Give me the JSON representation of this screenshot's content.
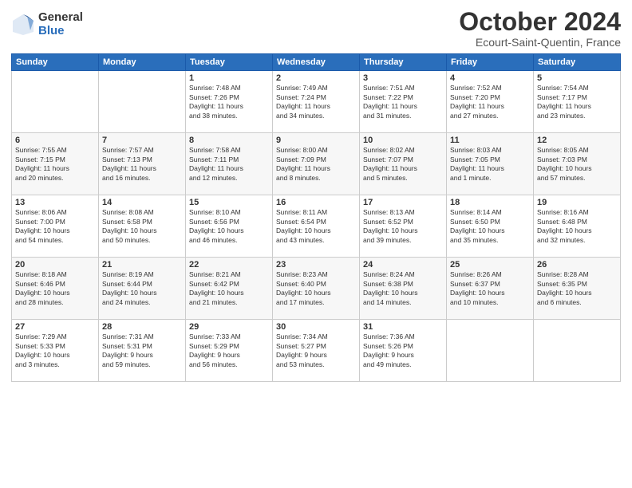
{
  "header": {
    "logo_general": "General",
    "logo_blue": "Blue",
    "month": "October 2024",
    "location": "Ecourt-Saint-Quentin, France"
  },
  "weekdays": [
    "Sunday",
    "Monday",
    "Tuesday",
    "Wednesday",
    "Thursday",
    "Friday",
    "Saturday"
  ],
  "weeks": [
    [
      {
        "day": "",
        "text": ""
      },
      {
        "day": "",
        "text": ""
      },
      {
        "day": "1",
        "text": "Sunrise: 7:48 AM\nSunset: 7:26 PM\nDaylight: 11 hours\nand 38 minutes."
      },
      {
        "day": "2",
        "text": "Sunrise: 7:49 AM\nSunset: 7:24 PM\nDaylight: 11 hours\nand 34 minutes."
      },
      {
        "day": "3",
        "text": "Sunrise: 7:51 AM\nSunset: 7:22 PM\nDaylight: 11 hours\nand 31 minutes."
      },
      {
        "day": "4",
        "text": "Sunrise: 7:52 AM\nSunset: 7:20 PM\nDaylight: 11 hours\nand 27 minutes."
      },
      {
        "day": "5",
        "text": "Sunrise: 7:54 AM\nSunset: 7:17 PM\nDaylight: 11 hours\nand 23 minutes."
      }
    ],
    [
      {
        "day": "6",
        "text": "Sunrise: 7:55 AM\nSunset: 7:15 PM\nDaylight: 11 hours\nand 20 minutes."
      },
      {
        "day": "7",
        "text": "Sunrise: 7:57 AM\nSunset: 7:13 PM\nDaylight: 11 hours\nand 16 minutes."
      },
      {
        "day": "8",
        "text": "Sunrise: 7:58 AM\nSunset: 7:11 PM\nDaylight: 11 hours\nand 12 minutes."
      },
      {
        "day": "9",
        "text": "Sunrise: 8:00 AM\nSunset: 7:09 PM\nDaylight: 11 hours\nand 8 minutes."
      },
      {
        "day": "10",
        "text": "Sunrise: 8:02 AM\nSunset: 7:07 PM\nDaylight: 11 hours\nand 5 minutes."
      },
      {
        "day": "11",
        "text": "Sunrise: 8:03 AM\nSunset: 7:05 PM\nDaylight: 11 hours\nand 1 minute."
      },
      {
        "day": "12",
        "text": "Sunrise: 8:05 AM\nSunset: 7:03 PM\nDaylight: 10 hours\nand 57 minutes."
      }
    ],
    [
      {
        "day": "13",
        "text": "Sunrise: 8:06 AM\nSunset: 7:00 PM\nDaylight: 10 hours\nand 54 minutes."
      },
      {
        "day": "14",
        "text": "Sunrise: 8:08 AM\nSunset: 6:58 PM\nDaylight: 10 hours\nand 50 minutes."
      },
      {
        "day": "15",
        "text": "Sunrise: 8:10 AM\nSunset: 6:56 PM\nDaylight: 10 hours\nand 46 minutes."
      },
      {
        "day": "16",
        "text": "Sunrise: 8:11 AM\nSunset: 6:54 PM\nDaylight: 10 hours\nand 43 minutes."
      },
      {
        "day": "17",
        "text": "Sunrise: 8:13 AM\nSunset: 6:52 PM\nDaylight: 10 hours\nand 39 minutes."
      },
      {
        "day": "18",
        "text": "Sunrise: 8:14 AM\nSunset: 6:50 PM\nDaylight: 10 hours\nand 35 minutes."
      },
      {
        "day": "19",
        "text": "Sunrise: 8:16 AM\nSunset: 6:48 PM\nDaylight: 10 hours\nand 32 minutes."
      }
    ],
    [
      {
        "day": "20",
        "text": "Sunrise: 8:18 AM\nSunset: 6:46 PM\nDaylight: 10 hours\nand 28 minutes."
      },
      {
        "day": "21",
        "text": "Sunrise: 8:19 AM\nSunset: 6:44 PM\nDaylight: 10 hours\nand 24 minutes."
      },
      {
        "day": "22",
        "text": "Sunrise: 8:21 AM\nSunset: 6:42 PM\nDaylight: 10 hours\nand 21 minutes."
      },
      {
        "day": "23",
        "text": "Sunrise: 8:23 AM\nSunset: 6:40 PM\nDaylight: 10 hours\nand 17 minutes."
      },
      {
        "day": "24",
        "text": "Sunrise: 8:24 AM\nSunset: 6:38 PM\nDaylight: 10 hours\nand 14 minutes."
      },
      {
        "day": "25",
        "text": "Sunrise: 8:26 AM\nSunset: 6:37 PM\nDaylight: 10 hours\nand 10 minutes."
      },
      {
        "day": "26",
        "text": "Sunrise: 8:28 AM\nSunset: 6:35 PM\nDaylight: 10 hours\nand 6 minutes."
      }
    ],
    [
      {
        "day": "27",
        "text": "Sunrise: 7:29 AM\nSunset: 5:33 PM\nDaylight: 10 hours\nand 3 minutes."
      },
      {
        "day": "28",
        "text": "Sunrise: 7:31 AM\nSunset: 5:31 PM\nDaylight: 9 hours\nand 59 minutes."
      },
      {
        "day": "29",
        "text": "Sunrise: 7:33 AM\nSunset: 5:29 PM\nDaylight: 9 hours\nand 56 minutes."
      },
      {
        "day": "30",
        "text": "Sunrise: 7:34 AM\nSunset: 5:27 PM\nDaylight: 9 hours\nand 53 minutes."
      },
      {
        "day": "31",
        "text": "Sunrise: 7:36 AM\nSunset: 5:26 PM\nDaylight: 9 hours\nand 49 minutes."
      },
      {
        "day": "",
        "text": ""
      },
      {
        "day": "",
        "text": ""
      }
    ]
  ]
}
